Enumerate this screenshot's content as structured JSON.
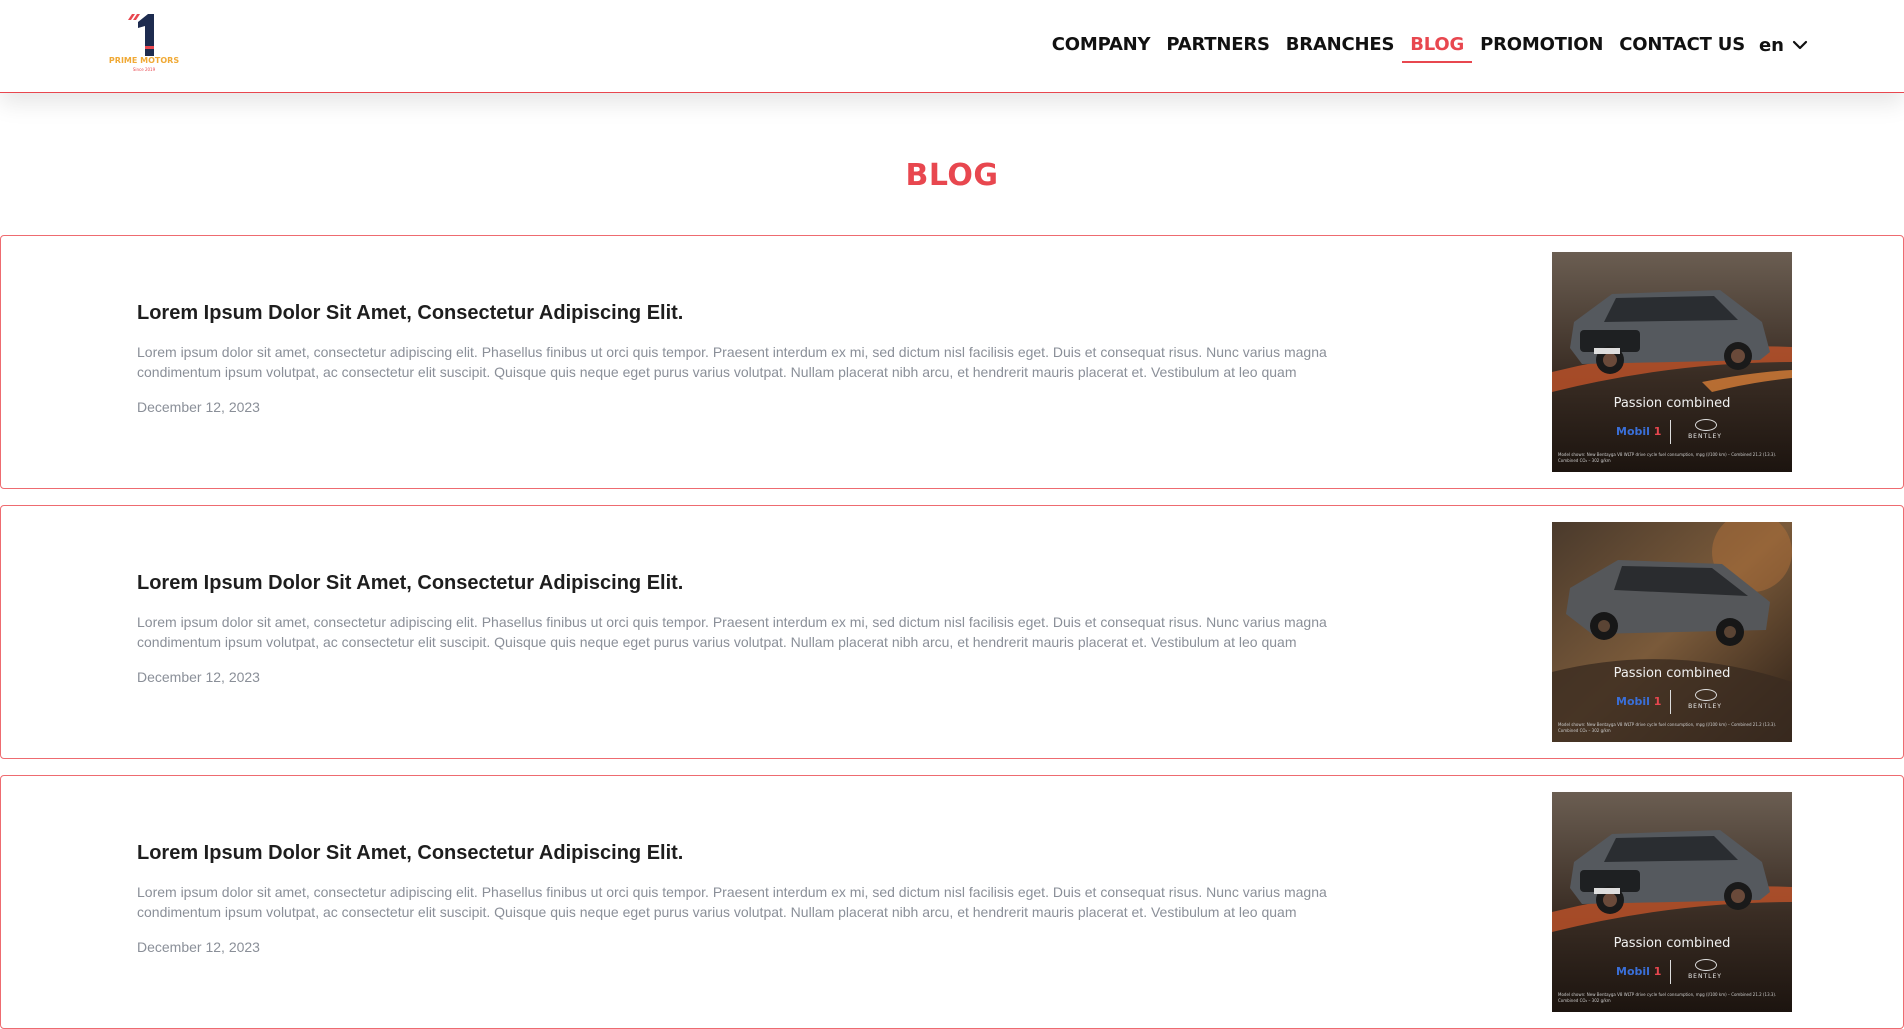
{
  "brand": {
    "name": "PRIME MOTORS",
    "tagline": "Since 2019",
    "colors": {
      "accent": "#e8474f",
      "navy": "#1d2b4f",
      "gold": "#f0a935"
    }
  },
  "nav": {
    "items": [
      {
        "label": "COMPANY",
        "active": false
      },
      {
        "label": "PARTNERS",
        "active": false
      },
      {
        "label": "BRANCHES",
        "active": false
      },
      {
        "label": "BLOG",
        "active": true
      },
      {
        "label": "PROMOTION",
        "active": false
      },
      {
        "label": "CONTACT US",
        "active": false
      }
    ],
    "language": "en",
    "language_icon": "chevron-down-icon"
  },
  "page": {
    "title": "BLOG"
  },
  "posts": [
    {
      "title": "Lorem Ipsum Dolor Sit Amet, Consectetur Adipiscing Elit.",
      "excerpt": "Lorem ipsum dolor sit amet, consectetur adipiscing elit. Phasellus finibus ut orci quis tempor. Praesent interdum ex mi, sed dictum nisl facilisis eget. Duis et consequat risus. Nunc varius magna condimentum ipsum volutpat, ac consectetur elit suscipit. Quisque quis neque eget purus varius volutpat. Nullam placerat nibh arcu, et hendrerit mauris placerat et. Vestibulum at leo quam",
      "date": "December 12, 2023",
      "image": {
        "caption": "Passion combined",
        "brand_left": "Mobil",
        "brand_left_num": "1",
        "brand_right": "BENTLEY",
        "fine_print": "Model shown: New Bentayga V8 WLTP drive cycle fuel consumption, mpg (l/100 km) – Combined 21.2 (13.3). Combined CO₂ – 302 g/km"
      }
    },
    {
      "title": "Lorem Ipsum Dolor Sit Amet, Consectetur Adipiscing Elit.",
      "excerpt": "Lorem ipsum dolor sit amet, consectetur adipiscing elit. Phasellus finibus ut orci quis tempor. Praesent interdum ex mi, sed dictum nisl facilisis eget. Duis et consequat risus. Nunc varius magna condimentum ipsum volutpat, ac consectetur elit suscipit. Quisque quis neque eget purus varius volutpat. Nullam placerat nibh arcu, et hendrerit mauris placerat et. Vestibulum at leo quam",
      "date": "December 12, 2023",
      "image": {
        "caption": "Passion combined",
        "brand_left": "Mobil",
        "brand_left_num": "1",
        "brand_right": "BENTLEY",
        "fine_print": "Model shown: New Bentayga V8 WLTP drive cycle fuel consumption, mpg (l/100 km) – Combined 21.2 (13.3). Combined CO₂ – 302 g/km"
      }
    },
    {
      "title": "Lorem Ipsum Dolor Sit Amet, Consectetur Adipiscing Elit.",
      "excerpt": "Lorem ipsum dolor sit amet, consectetur adipiscing elit. Phasellus finibus ut orci quis tempor. Praesent interdum ex mi, sed dictum nisl facilisis eget. Duis et consequat risus. Nunc varius magna condimentum ipsum volutpat, ac consectetur elit suscipit. Quisque quis neque eget purus varius volutpat. Nullam placerat nibh arcu, et hendrerit mauris placerat et. Vestibulum at leo quam",
      "date": "December 12, 2023",
      "image": {
        "caption": "Passion combined",
        "brand_left": "Mobil",
        "brand_left_num": "1",
        "brand_right": "BENTLEY",
        "fine_print": "Model shown: New Bentayga V8 WLTP drive cycle fuel consumption, mpg (l/100 km) – Combined 21.2 (13.3). Combined CO₂ – 302 g/km"
      }
    }
  ]
}
